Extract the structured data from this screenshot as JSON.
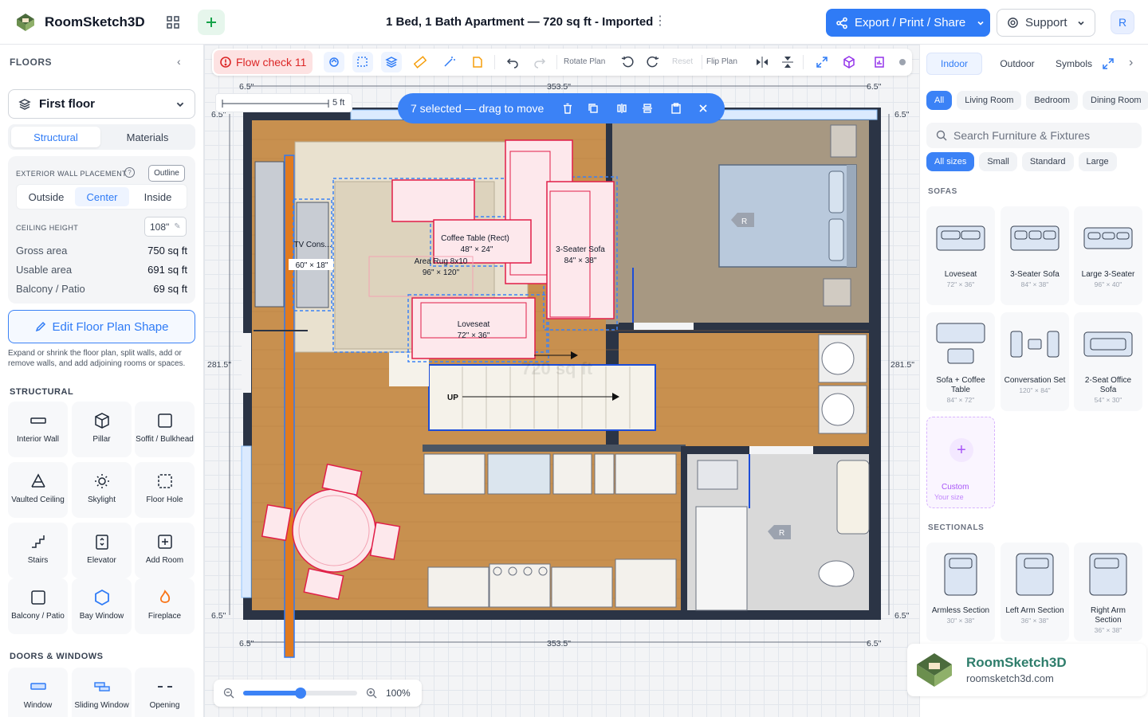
{
  "app": {
    "name": "RoomSketch3D",
    "doc_title": "1 Bed, 1 Bath Apartment — 720 sq ft - Imported"
  },
  "header": {
    "export_label": "Export / Print / Share",
    "support_label": "Support",
    "avatar": "R"
  },
  "left": {
    "heading": "FLOORS",
    "floor": "First floor",
    "tabs": [
      "Structural",
      "Materials"
    ],
    "wall_placement_label": "EXTERIOR WALL PLACEMENT",
    "outline": "Outline",
    "wall_opts": [
      "Outside",
      "Center",
      "Inside"
    ],
    "ceiling_label": "CEILING HEIGHT",
    "ceiling_value": "108\"",
    "stats": [
      {
        "label": "Gross area",
        "value": "750 sq ft"
      },
      {
        "label": "Usable area",
        "value": "691 sq ft"
      },
      {
        "label": "Balcony / Patio",
        "value": "69 sq ft"
      }
    ],
    "edit_shape": "Edit Floor Plan Shape",
    "edit_desc": "Expand or shrink the floor plan, split walls, add or remove walls, and add adjoining rooms or spaces.",
    "structural_heading": "STRUCTURAL",
    "tools": [
      "Interior Wall",
      "Pillar",
      "Soffit / Bulkhead",
      "Vaulted Ceiling",
      "Skylight",
      "Floor Hole",
      "Stairs",
      "Elevator",
      "Add Room",
      "Balcony / Patio",
      "Bay Window",
      "Fireplace"
    ],
    "doors_heading": "DOORS & WINDOWS",
    "door_tools": [
      "Window",
      "Sliding Window",
      "Opening"
    ]
  },
  "toolbar": {
    "flow_check": "Flow check 11",
    "rotate": "Rotate Plan",
    "reset": "Reset",
    "flip": "Flip Plan"
  },
  "selection": {
    "label": "7 selected — drag to move"
  },
  "scale": {
    "label": "5 ft"
  },
  "zoom": {
    "value": "100%",
    "level": 0.5
  },
  "plan": {
    "dims": {
      "top_margin": "6.5\"",
      "width": "353.5\"",
      "height": "281.5\""
    },
    "labels": {
      "tv": "TV Cons...",
      "tv_size": "60\" × 18\"",
      "coffee": "Coffee Table (Rect)",
      "coffee_size": "48\" × 24\"",
      "rug": "Area Rug 8x10",
      "rug_size": "96\" × 120\"",
      "sofa": "3-Seater Sofa",
      "sofa_size": "84\" × 38\"",
      "loveseat": "Loveseat",
      "loveseat_size": "72\" × 36\"",
      "up": "UP",
      "area_ghost": "720 sq ft",
      "r": "R"
    }
  },
  "right": {
    "tabs": [
      "Indoor",
      "Outdoor",
      "Symbols"
    ],
    "rooms": [
      "All",
      "Living Room",
      "Bedroom",
      "Dining Room"
    ],
    "search_placeholder": "Search Furniture & Fixtures",
    "sizes": [
      "All sizes",
      "Small",
      "Standard",
      "Large"
    ],
    "sofas_heading": "SOFAS",
    "sofas": [
      {
        "name": "Loveseat",
        "size": "72\" × 36\""
      },
      {
        "name": "3-Seater Sofa",
        "size": "84\" × 38\""
      },
      {
        "name": "Large 3-Seater",
        "size": "96\" × 40\""
      },
      {
        "name": "Sofa + Coffee Table",
        "size": "84\" × 72\""
      },
      {
        "name": "Conversation Set",
        "size": "120\" × 84\""
      },
      {
        "name": "2-Seat Office Sofa",
        "size": "54\" × 30\""
      }
    ],
    "custom": {
      "label": "Custom",
      "sub": "Your size"
    },
    "sectionals_heading": "SECTIONALS",
    "sectionals": [
      {
        "name": "Armless Section",
        "size": "30\" × 38\""
      },
      {
        "name": "Left Arm Section",
        "size": "36\" × 38\""
      },
      {
        "name": "Right Arm Section",
        "size": "36\" × 38\""
      }
    ]
  },
  "watermark": {
    "brand": "RoomSketch3D",
    "url": "roomsketch3d.com"
  },
  "colors": {
    "accent": "#2f7bf6",
    "wood": "#c8904f",
    "wall": "#2b3445",
    "select": "#3b82f6",
    "furniture": "#e11d48"
  }
}
